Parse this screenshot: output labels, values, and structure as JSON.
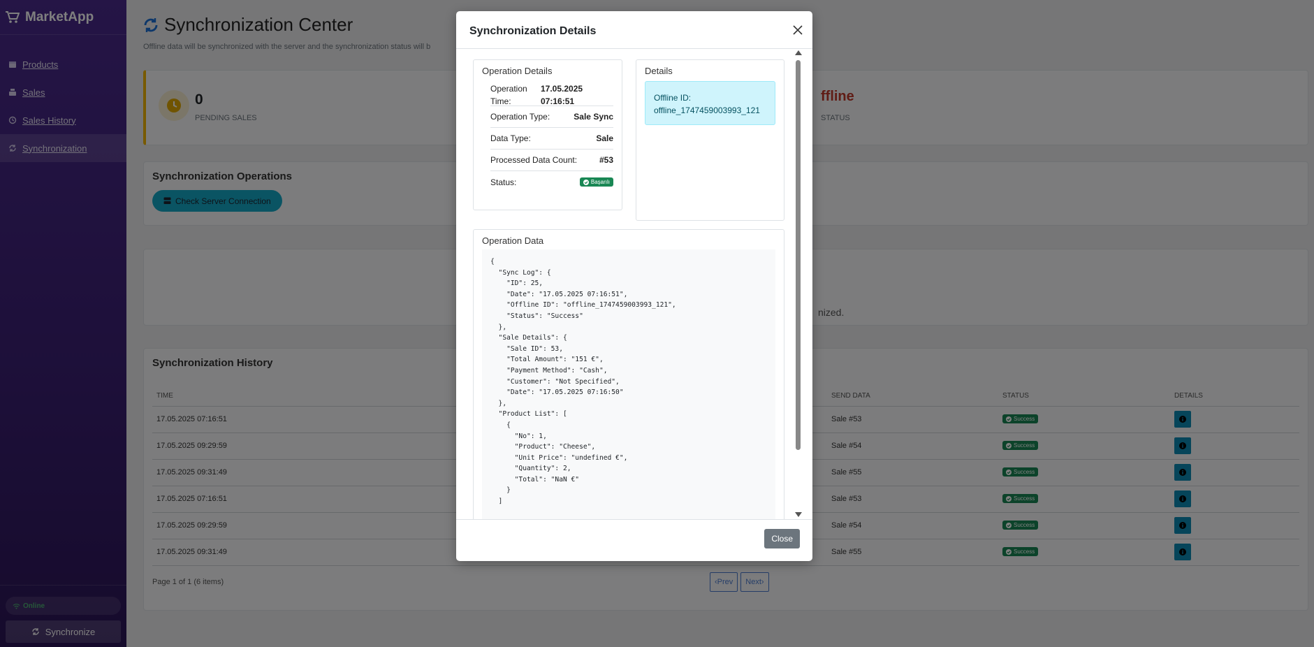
{
  "sidebar": {
    "brand": "MarketApp",
    "items": [
      {
        "label": "Products"
      },
      {
        "label": "Sales"
      },
      {
        "label": "Sales History"
      },
      {
        "label": "Synchronization"
      }
    ],
    "status": "Online",
    "sync_button": "Synchronize"
  },
  "page": {
    "title": "Synchronization Center",
    "subtitle": "Offline data will be synchronized with the server and the synchronization status will b"
  },
  "stats": {
    "pending_value": "0",
    "pending_label": "PENDING SALES",
    "status_value": "ffline",
    "status_label": "STATUS"
  },
  "operations": {
    "title": "Synchronization Operations",
    "check_button": "Check Server Connection"
  },
  "pending": {
    "text": "nized."
  },
  "history": {
    "title": "Synchronization History",
    "columns": [
      "TIME",
      "SEND DATA",
      "STATUS",
      "DETAILS"
    ],
    "rows": [
      {
        "time": "17.05.2025 07:16:51",
        "data": "Sale #53",
        "status": "Success"
      },
      {
        "time": "17.05.2025 09:29:59",
        "data": "Sale #54",
        "status": "Success"
      },
      {
        "time": "17.05.2025 09:31:49",
        "data": "Sale #55",
        "status": "Success"
      },
      {
        "time": "17.05.2025 07:16:51",
        "data": "Sale #53",
        "status": "Success"
      },
      {
        "time": "17.05.2025 09:29:59",
        "data": "Sale #54",
        "status": "Success"
      },
      {
        "time": "17.05.2025 09:31:49",
        "data": "Sale #55",
        "status": "Success"
      }
    ],
    "page_info": "Page 1 of 1 (6 items)",
    "prev": "Prev",
    "next": "Next"
  },
  "modal": {
    "title": "Synchronization Details",
    "op_details": {
      "title": "Operation Details",
      "time_label": "Operation Time:",
      "time_date": "17.05.2025",
      "time_clock": "07:16:51",
      "type_label": "Operation Type:",
      "type_value": "Sale Sync",
      "data_type_label": "Data Type:",
      "data_type_value": "Sale",
      "count_label": "Processed Data Count:",
      "count_value": "#53",
      "status_label": "Status:",
      "status_value": "Başarılı"
    },
    "details": {
      "title": "Details",
      "offline_label": "Offline ID:",
      "offline_value": "offline_1747459003993_121"
    },
    "op_data": {
      "title": "Operation Data",
      "json": "{\n  \"Sync Log\": {\n    \"ID\": 25,\n    \"Date\": \"17.05.2025 07:16:51\",\n    \"Offline ID\": \"offline_1747459003993_121\",\n    \"Status\": \"Success\"\n  },\n  \"Sale Details\": {\n    \"Sale ID\": 53,\n    \"Total Amount\": \"151 €\",\n    \"Payment Method\": \"Cash\",\n    \"Customer\": \"Not Specified\",\n    \"Date\": \"17.05.2025 07:16:50\"\n  },\n  \"Product List\": [\n    {\n      \"No\": 1,\n      \"Product\": \"Cheese\",\n      \"Unit Price\": \"undefined €\",\n      \"Quantity\": 2,\n      \"Total\": \"NaN €\"\n    }\n  ]"
    },
    "close_button": "Close"
  }
}
